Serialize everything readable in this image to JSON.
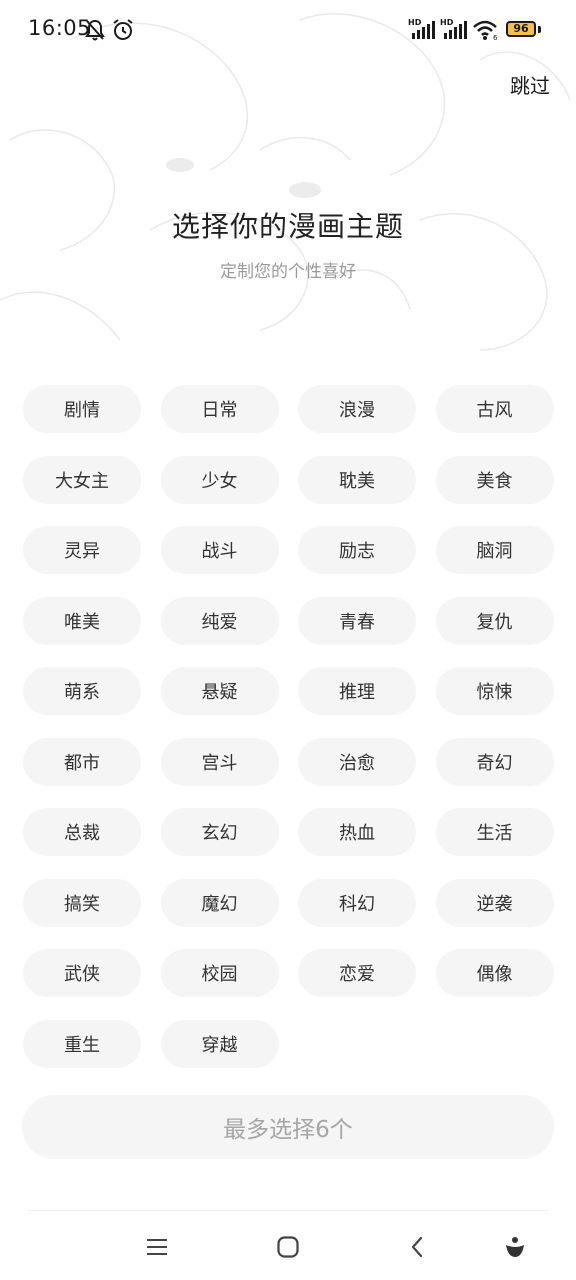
{
  "status_bar": {
    "time": "16:05",
    "battery": "96",
    "icons": [
      "bell-off-icon",
      "alarm-icon",
      "hd-signal-icon",
      "hd-signal-icon",
      "wifi-icon",
      "battery-icon"
    ]
  },
  "header": {
    "skip_label": "跳过"
  },
  "main": {
    "title": "选择你的漫画主题",
    "subtitle": "定制您的个性喜好"
  },
  "tags": [
    "剧情",
    "日常",
    "浪漫",
    "古风",
    "大女主",
    "少女",
    "耽美",
    "美食",
    "灵异",
    "战斗",
    "励志",
    "脑洞",
    "唯美",
    "纯爱",
    "青春",
    "复仇",
    "萌系",
    "悬疑",
    "推理",
    "惊悚",
    "都市",
    "宫斗",
    "治愈",
    "奇幻",
    "总裁",
    "玄幻",
    "热血",
    "生活",
    "搞笑",
    "魔幻",
    "科幻",
    "逆袭",
    "武侠",
    "校园",
    "恋爱",
    "偶像",
    "重生",
    "穿越"
  ],
  "confirm": {
    "label": "最多选择6个"
  },
  "navbar": {
    "icons": [
      "menu-icon",
      "home-icon",
      "back-icon",
      "assistant-icon"
    ]
  },
  "colors": {
    "tag_background": "#f5f5f5",
    "muted_text": "#a6a6a6",
    "battery": "#f4c24a"
  }
}
